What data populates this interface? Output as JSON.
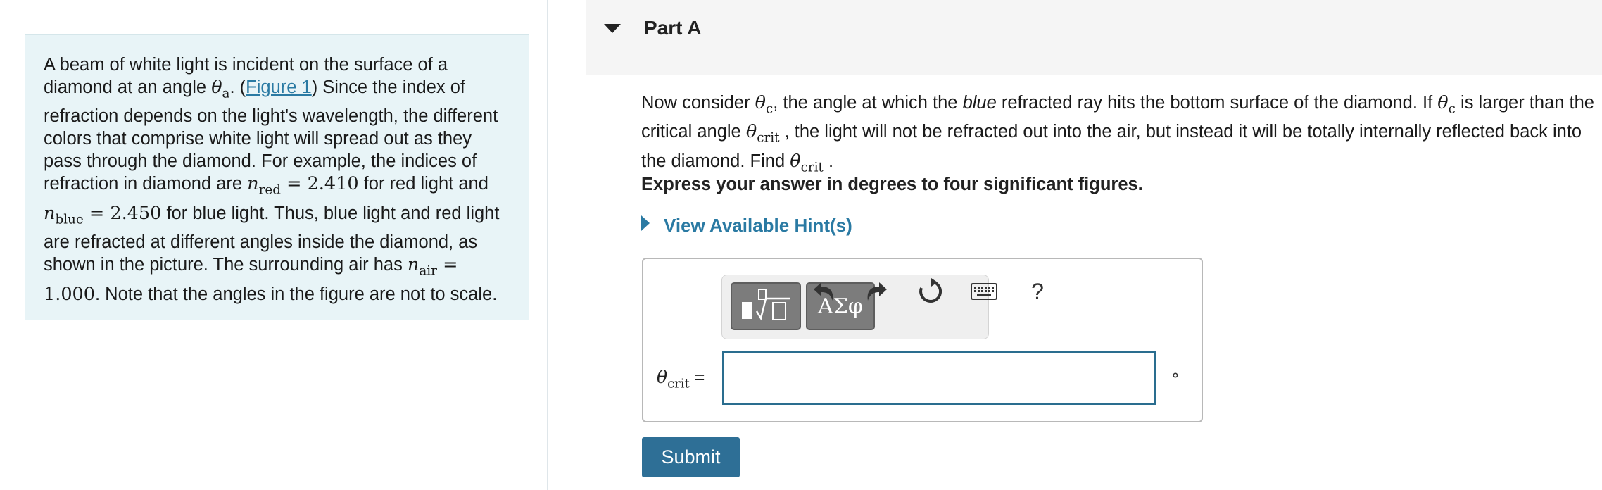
{
  "intro": {
    "s1": "A beam of white light is incident on the surface of a diamond at an angle ",
    "theta": "θ",
    "theta_sub": "a",
    "s2": ". (",
    "figure_link": "Figure 1",
    "s3": ") Since the index of refraction depends on the light's wavelength, the different colors that comprise white light will spread out as they pass through the diamond. For example, the indices of refraction in diamond are ",
    "n": "n",
    "n_red_sub": "red",
    "eq": " = ",
    "n_red_value": "2.410",
    "s4": " for red light and ",
    "n_blue_sub": "blue",
    "n_blue_value": "2.450",
    "s5": " for blue light. Thus, blue light and red light are refracted at different angles inside the diamond, as shown in the picture. The surrounding air has ",
    "n_air_sub": "air",
    "n_air_value": "1.000",
    "s6": ". Note that the angles in the figure are not to scale."
  },
  "part": {
    "title": "Part A"
  },
  "question": {
    "q1": "Now consider ",
    "theta": "θ",
    "c_sub": "c",
    "q2": ", the angle at which the ",
    "blue_word": "blue",
    "q3": " refracted ray hits the bottom surface of the diamond. If ",
    "q4": " is larger than the critical angle ",
    "crit_sub": "crit",
    "q5": " , the light will not be refracted out into the air, but instead it will be totally internally reflected back into the diamond. Find ",
    "q6": " ."
  },
  "instruction": "Express your answer in degrees to four significant figures.",
  "hints_label": "View Available Hint(s)",
  "toolbar": {
    "symbols_label": "ΑΣφ",
    "help_label": "?"
  },
  "answer": {
    "label_theta": "θ",
    "label_sub": "crit",
    "equals": " =",
    "value": "",
    "unit": "∘"
  },
  "submit_label": "Submit"
}
